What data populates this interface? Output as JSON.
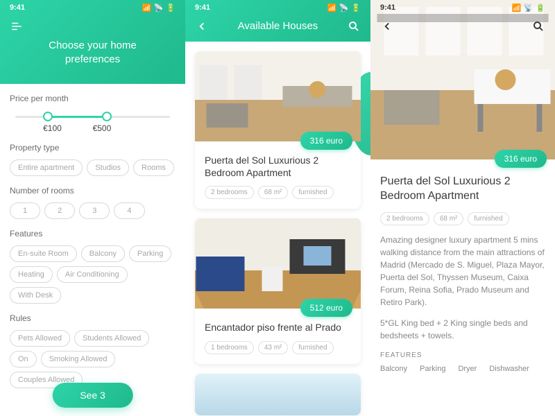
{
  "status": {
    "time": "9:41"
  },
  "screen1": {
    "title": "Choose your home preferences",
    "price_label": "Price per month",
    "price_min": "€100",
    "price_max": "€500",
    "type_label": "Property type",
    "types": [
      "Entire apartment",
      "Studios",
      "Rooms"
    ],
    "rooms_label": "Number of rooms",
    "rooms": [
      "1",
      "2",
      "3",
      "4"
    ],
    "features_label": "Features",
    "features": [
      "En-suite Room",
      "Balcony",
      "Parking",
      "Heating",
      "Air Conditioning",
      "With Desk"
    ],
    "rules_label": "Rules",
    "rules": [
      "Pets Allowed",
      "Students Allowed",
      "On",
      "Smoking Allowed",
      "Couples Allowed"
    ],
    "cta": "See 3"
  },
  "screen2": {
    "title": "Available Houses",
    "listings": [
      {
        "price": "316 euro",
        "title": "Puerta del Sol Luxurious 2 Bedroom Apartment",
        "chips": [
          "2 bedrooms",
          "68 m²",
          "furnished"
        ]
      },
      {
        "price": "512 euro",
        "title": "Encantador piso frente al Prado",
        "chips": [
          "1 bedrooms",
          "43 m²",
          "furnished"
        ]
      }
    ]
  },
  "screen3": {
    "price": "316 euro",
    "title": "Puerta del Sol Luxurious 2 Bedroom Apartment",
    "chips": [
      "2 bedrooms",
      "68 m²",
      "furnished"
    ],
    "desc1": "Amazing designer luxury apartment 5 mins walking distance from the main attractions of Madrid (Mercado de S. Miguel, Plaza Mayor, Puerta del Sol, Thyssen Museum, Caixa Forum, Reina Sofia, Prado Museum and Retiro Park).",
    "desc2": "5*GL King bed + 2 King single beds and bedsheets + towels.",
    "feat_label": "FEATURES",
    "feats": [
      "Balcony",
      "Parking",
      "Dryer",
      "Dishwasher"
    ]
  }
}
